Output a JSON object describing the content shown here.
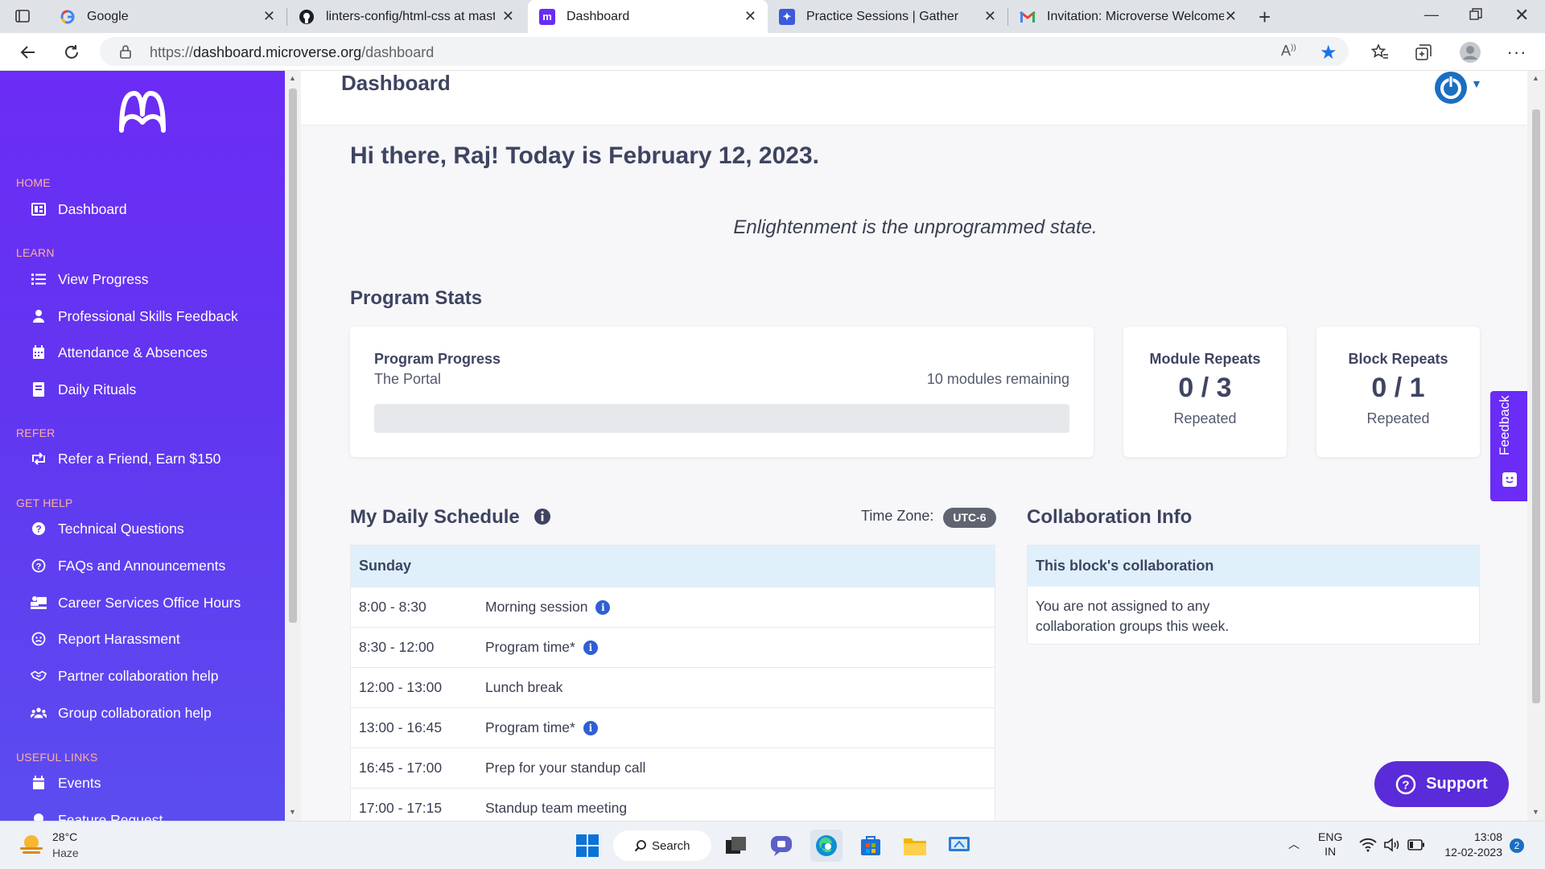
{
  "browser": {
    "tabs": [
      {
        "title": "Google",
        "favicon": "google-icon"
      },
      {
        "title": "linters-config/html-css at master",
        "favicon": "github-icon"
      },
      {
        "title": "Dashboard",
        "favicon": "microverse-icon",
        "active": true
      },
      {
        "title": "Practice Sessions | Gather",
        "favicon": "gather-icon"
      },
      {
        "title": "Invitation: Microverse Welcome C",
        "favicon": "gmail-icon"
      }
    ],
    "url_prefix": "https://",
    "url_domain": "dashboard.microverse.org",
    "url_path": "/dashboard"
  },
  "sidebar": {
    "sections": [
      {
        "label": "HOME",
        "items": [
          {
            "label": "Dashboard",
            "icon": "dashboard-icon"
          }
        ]
      },
      {
        "label": "LEARN",
        "items": [
          {
            "label": "View Progress",
            "icon": "list-icon"
          },
          {
            "label": "Professional Skills Feedback",
            "icon": "user-icon"
          },
          {
            "label": "Attendance & Absences",
            "icon": "calendar-icon"
          },
          {
            "label": "Daily Rituals",
            "icon": "book-icon"
          }
        ]
      },
      {
        "label": "REFER",
        "items": [
          {
            "label": "Refer a Friend, Earn $150",
            "icon": "retweet-icon"
          }
        ]
      },
      {
        "label": "GET HELP",
        "items": [
          {
            "label": "Technical Questions",
            "icon": "question-circle-icon"
          },
          {
            "label": "FAQs and Announcements",
            "icon": "question-outline-icon"
          },
          {
            "label": "Career Services Office Hours",
            "icon": "people-desk-icon"
          },
          {
            "label": "Report Harassment",
            "icon": "shield-face-icon"
          },
          {
            "label": "Partner collaboration help",
            "icon": "handshake-icon"
          },
          {
            "label": "Group collaboration help",
            "icon": "group-icon"
          }
        ]
      },
      {
        "label": "USEFUL LINKS",
        "items": [
          {
            "label": "Events",
            "icon": "calendar-event-icon"
          },
          {
            "label": "Feature Request",
            "icon": "lightbulb-icon"
          }
        ]
      }
    ]
  },
  "header": {
    "title": "Dashboard"
  },
  "greeting": "Hi there, Raj! Today is February 12, 2023.",
  "quote": "Enlightenment is the unprogrammed state.",
  "program_stats": {
    "heading": "Program Stats",
    "progress": {
      "title": "Program Progress",
      "subtitle": "The Portal",
      "remaining": "10 modules remaining",
      "fraction": 0
    },
    "module_repeats": {
      "title": "Module Repeats",
      "value": "0 / 3",
      "caption": "Repeated"
    },
    "block_repeats": {
      "title": "Block Repeats",
      "value": "0 / 1",
      "caption": "Repeated"
    }
  },
  "schedule": {
    "heading": "My Daily Schedule",
    "timezone_label": "Time Zone:",
    "timezone": "UTC-6",
    "day": "Sunday",
    "rows": [
      {
        "time": "8:00 - 8:30",
        "activity": "Morning session",
        "info": true
      },
      {
        "time": "8:30 - 12:00",
        "activity": "Program time*",
        "info": true
      },
      {
        "time": "12:00 - 13:00",
        "activity": "Lunch break",
        "info": false
      },
      {
        "time": "13:00 - 16:45",
        "activity": "Program time*",
        "info": true
      },
      {
        "time": "16:45 - 17:00",
        "activity": "Prep for your standup call",
        "info": false
      },
      {
        "time": "17:00 - 17:15",
        "activity": "Standup team meeting",
        "info": false
      }
    ]
  },
  "collaboration": {
    "heading": "Collaboration Info",
    "subheading": "This block's collaboration",
    "message": "You are not assigned to any collaboration groups this week."
  },
  "feedback_tab": "Feedback",
  "support_button": "Support",
  "taskbar": {
    "weather_temp": "28°C",
    "weather_desc": "Haze",
    "search_label": "Search",
    "lang_top": "ENG",
    "lang_bottom": "IN",
    "time": "13:08",
    "date": "12-02-2023",
    "notifications": "2"
  },
  "colors": {
    "sidebar": "#6236f0",
    "accent": "#6a2cf6",
    "section_label": "#ffb199",
    "schedule_header": "#dff0fb",
    "support": "#5a2bd8"
  }
}
